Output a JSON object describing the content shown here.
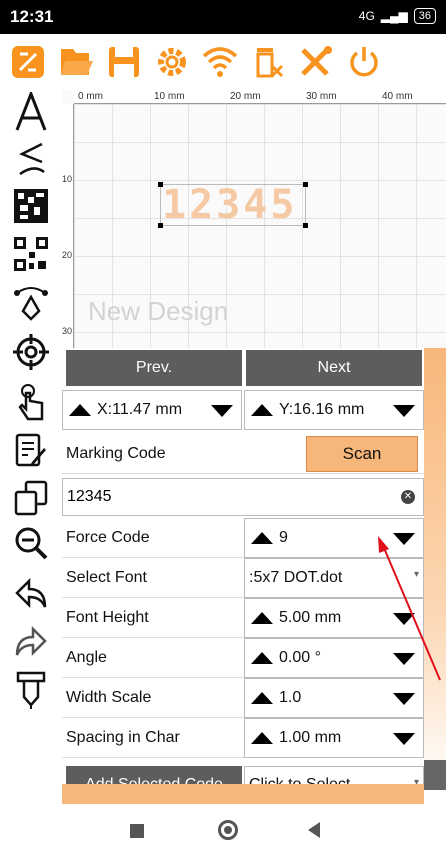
{
  "status": {
    "time": "12:31",
    "battery": "36",
    "network": "4G"
  },
  "toolbar": {
    "icons": [
      "logo-icon",
      "open-file-icon",
      "save-icon",
      "settings-icon",
      "wifi-icon",
      "delete-icon",
      "tools-icon",
      "power-icon"
    ],
    "accent": "#f7931e"
  },
  "sidebar": {
    "icons": [
      "text-icon",
      "arc-text-icon",
      "datamatrix-icon",
      "qrcode-icon",
      "pen-tool-icon",
      "target-icon",
      "hand-pointer-icon",
      "edit-icon",
      "copy-icon",
      "zoom-out-icon",
      "undo-icon",
      "redo-icon",
      "marker-icon"
    ]
  },
  "canvas": {
    "ruler_labels": [
      "0 mm",
      "10 mm",
      "20 mm",
      "30 mm",
      "40 mm"
    ],
    "vruler_labels": [
      "10",
      "20",
      "30"
    ],
    "watermark": "New Design",
    "code_text": "12345"
  },
  "nav": {
    "prev": "Prev.",
    "next": "Next"
  },
  "position": {
    "x": "X:11.47 mm",
    "y": "Y:16.16 mm"
  },
  "marking_code": {
    "label": "Marking Code",
    "scan": "Scan",
    "value": "12345"
  },
  "rows": [
    {
      "label": "Force Code",
      "value": "9"
    },
    {
      "label": "Select Font",
      "value": ":5x7 DOT.dot"
    },
    {
      "label": "Font Height",
      "value": "5.00 mm"
    },
    {
      "label": "Angle",
      "value": "0.00 °"
    },
    {
      "label": "Width Scale",
      "value": "1.0"
    },
    {
      "label": "Spacing in Char",
      "value": "1.00 mm"
    }
  ],
  "add_code": {
    "button": "Add Selected Code",
    "select": "Click to Select"
  }
}
